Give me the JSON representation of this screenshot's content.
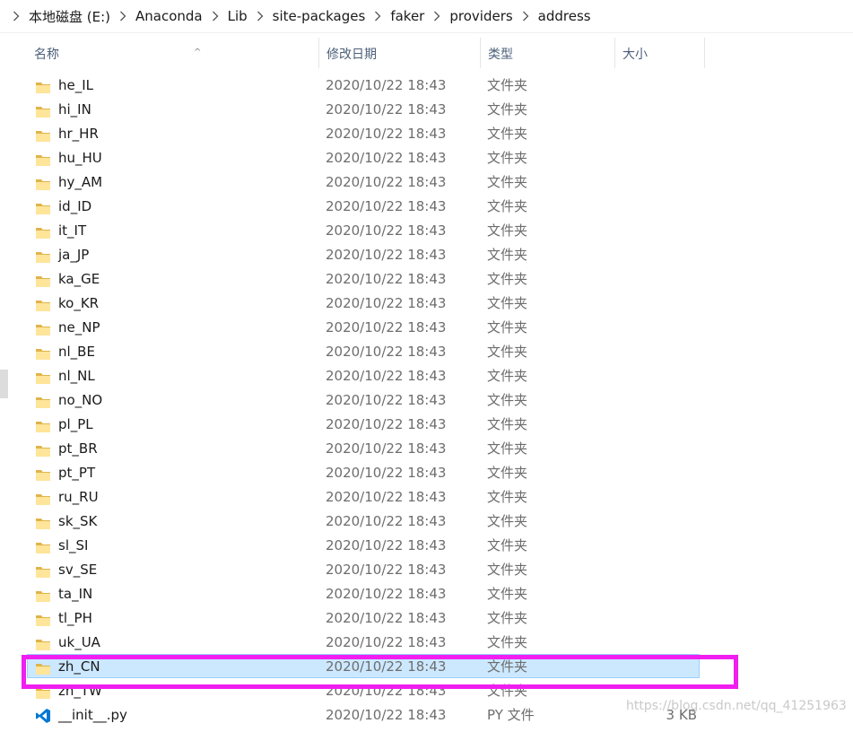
{
  "breadcrumb": [
    "本地磁盘 (E:)",
    "Anaconda",
    "Lib",
    "site-packages",
    "faker",
    "providers",
    "address"
  ],
  "columns": {
    "name": "名称",
    "date": "修改日期",
    "type": "类型",
    "size": "大小"
  },
  "rows": [
    {
      "name": "he_IL",
      "date": "2020/10/22 18:43",
      "type": "文件夹",
      "size": "",
      "icon": "folder-icon"
    },
    {
      "name": "hi_IN",
      "date": "2020/10/22 18:43",
      "type": "文件夹",
      "size": "",
      "icon": "folder-icon"
    },
    {
      "name": "hr_HR",
      "date": "2020/10/22 18:43",
      "type": "文件夹",
      "size": "",
      "icon": "folder-icon"
    },
    {
      "name": "hu_HU",
      "date": "2020/10/22 18:43",
      "type": "文件夹",
      "size": "",
      "icon": "folder-icon"
    },
    {
      "name": "hy_AM",
      "date": "2020/10/22 18:43",
      "type": "文件夹",
      "size": "",
      "icon": "folder-icon"
    },
    {
      "name": "id_ID",
      "date": "2020/10/22 18:43",
      "type": "文件夹",
      "size": "",
      "icon": "folder-icon"
    },
    {
      "name": "it_IT",
      "date": "2020/10/22 18:43",
      "type": "文件夹",
      "size": "",
      "icon": "folder-icon"
    },
    {
      "name": "ja_JP",
      "date": "2020/10/22 18:43",
      "type": "文件夹",
      "size": "",
      "icon": "folder-icon"
    },
    {
      "name": "ka_GE",
      "date": "2020/10/22 18:43",
      "type": "文件夹",
      "size": "",
      "icon": "folder-icon"
    },
    {
      "name": "ko_KR",
      "date": "2020/10/22 18:43",
      "type": "文件夹",
      "size": "",
      "icon": "folder-icon"
    },
    {
      "name": "ne_NP",
      "date": "2020/10/22 18:43",
      "type": "文件夹",
      "size": "",
      "icon": "folder-icon"
    },
    {
      "name": "nl_BE",
      "date": "2020/10/22 18:43",
      "type": "文件夹",
      "size": "",
      "icon": "folder-icon"
    },
    {
      "name": "nl_NL",
      "date": "2020/10/22 18:43",
      "type": "文件夹",
      "size": "",
      "icon": "folder-icon"
    },
    {
      "name": "no_NO",
      "date": "2020/10/22 18:43",
      "type": "文件夹",
      "size": "",
      "icon": "folder-icon"
    },
    {
      "name": "pl_PL",
      "date": "2020/10/22 18:43",
      "type": "文件夹",
      "size": "",
      "icon": "folder-icon"
    },
    {
      "name": "pt_BR",
      "date": "2020/10/22 18:43",
      "type": "文件夹",
      "size": "",
      "icon": "folder-icon"
    },
    {
      "name": "pt_PT",
      "date": "2020/10/22 18:43",
      "type": "文件夹",
      "size": "",
      "icon": "folder-icon"
    },
    {
      "name": "ru_RU",
      "date": "2020/10/22 18:43",
      "type": "文件夹",
      "size": "",
      "icon": "folder-icon"
    },
    {
      "name": "sk_SK",
      "date": "2020/10/22 18:43",
      "type": "文件夹",
      "size": "",
      "icon": "folder-icon"
    },
    {
      "name": "sl_SI",
      "date": "2020/10/22 18:43",
      "type": "文件夹",
      "size": "",
      "icon": "folder-icon"
    },
    {
      "name": "sv_SE",
      "date": "2020/10/22 18:43",
      "type": "文件夹",
      "size": "",
      "icon": "folder-icon"
    },
    {
      "name": "ta_IN",
      "date": "2020/10/22 18:43",
      "type": "文件夹",
      "size": "",
      "icon": "folder-icon"
    },
    {
      "name": "tl_PH",
      "date": "2020/10/22 18:43",
      "type": "文件夹",
      "size": "",
      "icon": "folder-icon"
    },
    {
      "name": "uk_UA",
      "date": "2020/10/22 18:43",
      "type": "文件夹",
      "size": "",
      "icon": "folder-icon"
    },
    {
      "name": "zh_CN",
      "date": "2020/10/22 18:43",
      "type": "文件夹",
      "size": "",
      "icon": "folder-icon",
      "selected": true
    },
    {
      "name": "zh_TW",
      "date": "2020/10/22 18:43",
      "type": "文件夹",
      "size": "",
      "icon": "folder-icon"
    },
    {
      "name": "__init__.py",
      "date": "2020/10/22 18:43",
      "type": "PY 文件",
      "size": "3 KB",
      "icon": "vscode-file-icon"
    }
  ],
  "watermark": "https://blog.csdn.net/qq_41251963",
  "colors": {
    "selection_bg": "#cce8ff",
    "selection_border": "#99d1ff",
    "highlight_annotation": "#f01ef0",
    "folder": "#f8d775",
    "vscode": "#0078d4"
  }
}
